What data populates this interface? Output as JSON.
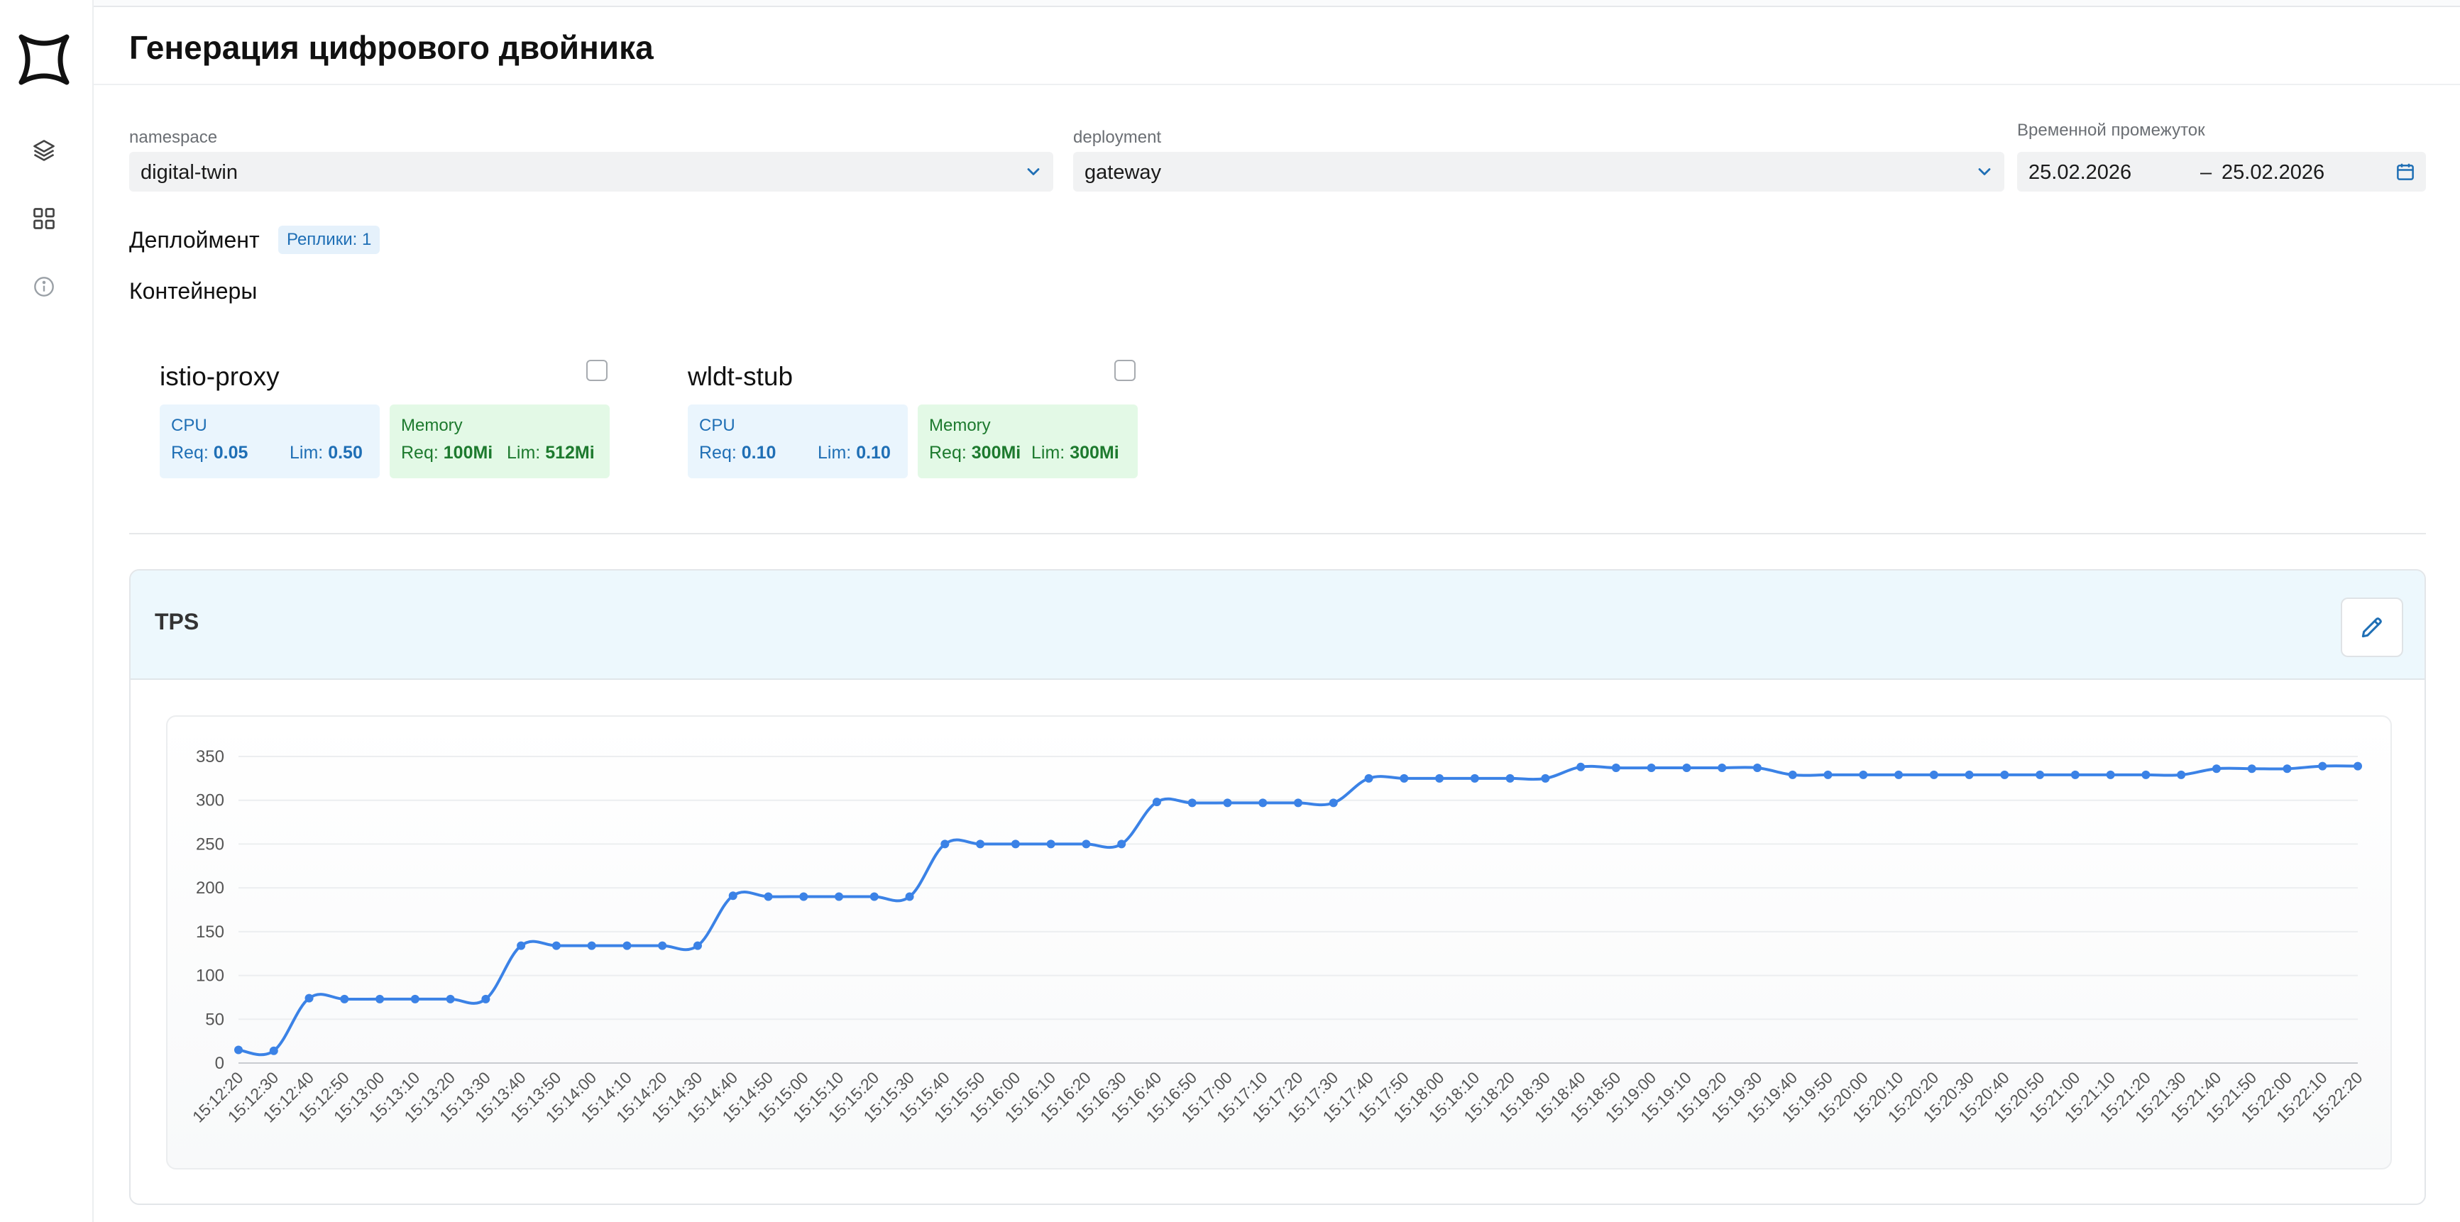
{
  "page": {
    "title": "Генерация цифрового двойника"
  },
  "sidebar": {
    "items": [
      {
        "icon": "layers-icon"
      },
      {
        "icon": "grid-icon"
      },
      {
        "icon": "info-icon"
      }
    ]
  },
  "filters": {
    "namespace": {
      "label": "namespace",
      "value": "digital-twin"
    },
    "deployment": {
      "label": "deployment",
      "value": "gateway"
    },
    "time_range": {
      "label": "Временной промежуток",
      "from": "25.02.2026",
      "separator": "–",
      "to": "25.02.2026"
    }
  },
  "deployment_section": {
    "title": "Деплоймент",
    "replicas_badge": "Реплики: 1"
  },
  "containers_section": {
    "title": "Контейнеры",
    "items": [
      {
        "name": "istio-proxy",
        "cpu": {
          "title": "CPU",
          "req_label": "Req:",
          "req": "0.05",
          "lim_label": "Lim:",
          "lim": "0.50"
        },
        "memory": {
          "title": "Memory",
          "req_label": "Req:",
          "req": "100Mi",
          "lim_label": "Lim:",
          "lim": "512Mi"
        }
      },
      {
        "name": "wldt-stub",
        "cpu": {
          "title": "CPU",
          "req_label": "Req:",
          "req": "0.10",
          "lim_label": "Lim:",
          "lim": "0.10"
        },
        "memory": {
          "title": "Memory",
          "req_label": "Req:",
          "req": "300Mi",
          "lim_label": "Lim:",
          "lim": "300Mi"
        }
      }
    ]
  },
  "colors": {
    "accent": "#3b82e6",
    "cpu_text": "#1f6fb5",
    "memory_text": "#1d7a2e"
  },
  "panel": {
    "title": "TPS",
    "edit_icon": "pencil-icon"
  },
  "chart_data": {
    "type": "line",
    "title": "",
    "xlabel": "",
    "ylabel": "",
    "ylim": [
      0,
      350
    ],
    "yticks": [
      0,
      50,
      100,
      150,
      200,
      250,
      300,
      350
    ],
    "grid": true,
    "x": [
      "15:12:20",
      "15:12:30",
      "15:12:40",
      "15:12:50",
      "15:13:00",
      "15:13:10",
      "15:13:20",
      "15:13:30",
      "15:13:40",
      "15:13:50",
      "15:14:00",
      "15:14:10",
      "15:14:20",
      "15:14:30",
      "15:14:40",
      "15:14:50",
      "15:15:00",
      "15:15:10",
      "15:15:20",
      "15:15:30",
      "15:15:40",
      "15:15:50",
      "15:16:00",
      "15:16:10",
      "15:16:20",
      "15:16:30",
      "15:16:40",
      "15:16:50",
      "15:17:00",
      "15:17:10",
      "15:17:20",
      "15:17:30",
      "15:17:40",
      "15:17:50",
      "15:18:00",
      "15:18:10",
      "15:18:20",
      "15:18:30",
      "15:18:40",
      "15:18:50",
      "15:19:00",
      "15:19:10",
      "15:19:20",
      "15:19:30",
      "15:19:40",
      "15:19:50",
      "15:20:00",
      "15:20:10",
      "15:20:20",
      "15:20:30",
      "15:20:40",
      "15:20:50",
      "15:21:00",
      "15:21:10",
      "15:21:20",
      "15:21:30",
      "15:21:40",
      "15:21:50",
      "15:22:00",
      "15:22:10",
      "15:22:20"
    ],
    "series": [
      {
        "values": [
          15,
          14,
          74,
          73,
          73,
          73,
          73,
          73,
          134,
          134,
          134,
          134,
          134,
          134,
          191,
          190,
          190,
          190,
          190,
          190,
          250,
          250,
          250,
          250,
          250,
          250,
          298,
          297,
          297,
          297,
          297,
          297,
          325,
          325,
          325,
          325,
          325,
          325,
          338,
          337,
          337,
          337,
          337,
          337,
          329,
          329,
          329,
          329,
          329,
          329,
          329,
          329,
          329,
          329,
          329,
          329,
          336,
          336,
          336,
          339,
          339
        ]
      }
    ]
  }
}
